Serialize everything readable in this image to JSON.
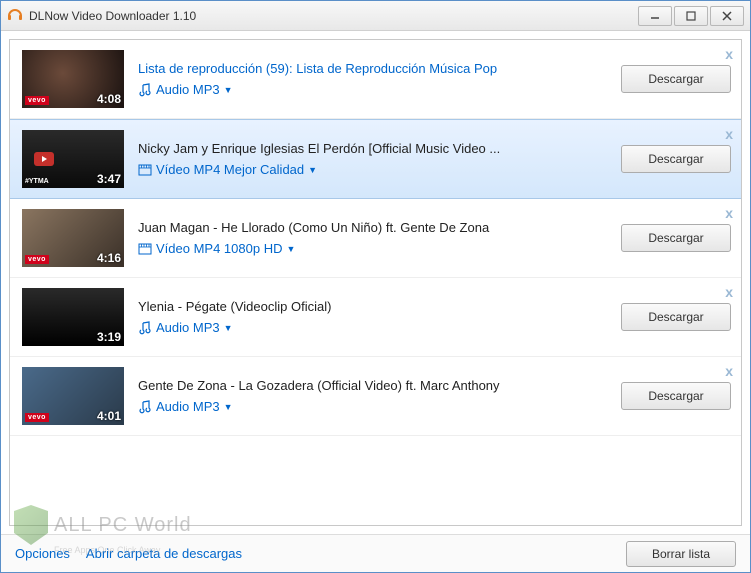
{
  "window": {
    "title": "DLNow Video Downloader 1.10"
  },
  "items": [
    {
      "title": "Lista de reproducción (59): Lista de Reproducción Música Pop",
      "title_link": true,
      "duration": "4:08",
      "format": "Audio MP3",
      "format_type": "audio",
      "download": "Descargar",
      "badge": "vevo",
      "selected": false,
      "bg": "bg1"
    },
    {
      "title": "Nicky Jam y Enrique Iglesias El Perdón [Official Music Video ...",
      "title_link": false,
      "duration": "3:47",
      "format": "Vídeo MP4 Mejor Calidad",
      "format_type": "video",
      "download": "Descargar",
      "badge": "ytma",
      "selected": true,
      "bg": "bg2"
    },
    {
      "title": "Juan Magan - He Llorado (Como Un Niño) ft. Gente De Zona",
      "title_link": false,
      "duration": "4:16",
      "format": "Vídeo MP4 1080p HD",
      "format_type": "video",
      "download": "Descargar",
      "badge": "vevo",
      "selected": false,
      "bg": "bg3"
    },
    {
      "title": "Ylenia - Pégate (Videoclip Oficial)",
      "title_link": false,
      "duration": "3:19",
      "format": "Audio MP3",
      "format_type": "audio",
      "download": "Descargar",
      "badge": "none",
      "selected": false,
      "bg": "bg4"
    },
    {
      "title": "Gente De Zona - La Gozadera (Official Video) ft. Marc Anthony",
      "title_link": false,
      "duration": "4:01",
      "format": "Audio MP3",
      "format_type": "audio",
      "download": "Descargar",
      "badge": "vevo",
      "selected": false,
      "bg": "bg5"
    }
  ],
  "footer": {
    "options": "Opciones",
    "open_folder": "Abrir carpeta de descargas",
    "clear": "Borrar lista"
  },
  "watermark": {
    "brand": "ALL PC World",
    "tagline": "Free Apps One Click Away"
  },
  "badges": {
    "vevo": "vevo",
    "ytma": "#YTMA"
  }
}
